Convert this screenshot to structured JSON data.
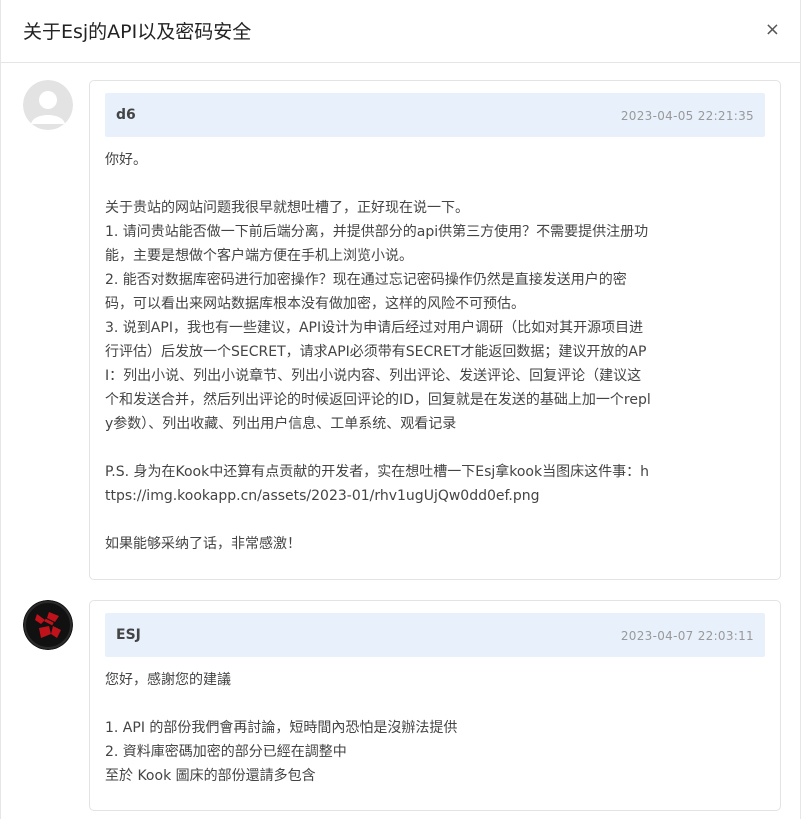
{
  "modal": {
    "title": "关于Esj的API以及密码安全",
    "close_label": "×"
  },
  "messages": [
    {
      "author": "d6",
      "time": "2023-04-05 22:21:35",
      "lines": [
        "你好。",
        "",
        "关于贵站的网站问题我很早就想吐槽了，正好现在说一下。",
        "1. 请问贵站能否做一下前后端分离，并提供部分的api供第三方使用？不需要提供注册功",
        "能，主要是想做个客户端方便在手机上浏览小说。",
        "2. 能否对数据库密码进行加密操作？现在通过忘记密码操作仍然是直接发送用户的密",
        "码，可以看出来网站数据库根本没有做加密，这样的风险不可预估。",
        "3. 说到API，我也有一些建议，API设计为申请后经过对用户调研（比如对其开源项目进",
        "行评估）后发放一个SECRET，请求API必须带有SECRET才能返回数据；建议开放的AP",
        "I：列出小说、列出小说章节、列出小说内容、列出评论、发送评论、回复评论（建议这",
        "个和发送合并，然后列出评论的时候返回评论的ID，回复就是在发送的基础上加一个repl",
        "y参数）、列出收藏、列出用户信息、工单系统、观看记录",
        "",
        "P.S. 身为在Kook中还算有点贡献的开发者，实在想吐槽一下Esj拿kook当图床这件事：h",
        "ttps://img.kookapp.cn/assets/2023-01/rhv1ugUjQw0dd0ef.png",
        "",
        "如果能够采纳了话，非常感激！"
      ]
    },
    {
      "author": "ESJ",
      "time": "2023-04-07 22:03:11",
      "lines": [
        "您好，感謝您的建議",
        "",
        "1. API 的部份我們會再討論，短時間內恐怕是沒辦法提供",
        "2. 資料庫密碼加密的部分已經在調整中",
        "至於 Kook 圖床的部份還請多包含"
      ]
    }
  ]
}
